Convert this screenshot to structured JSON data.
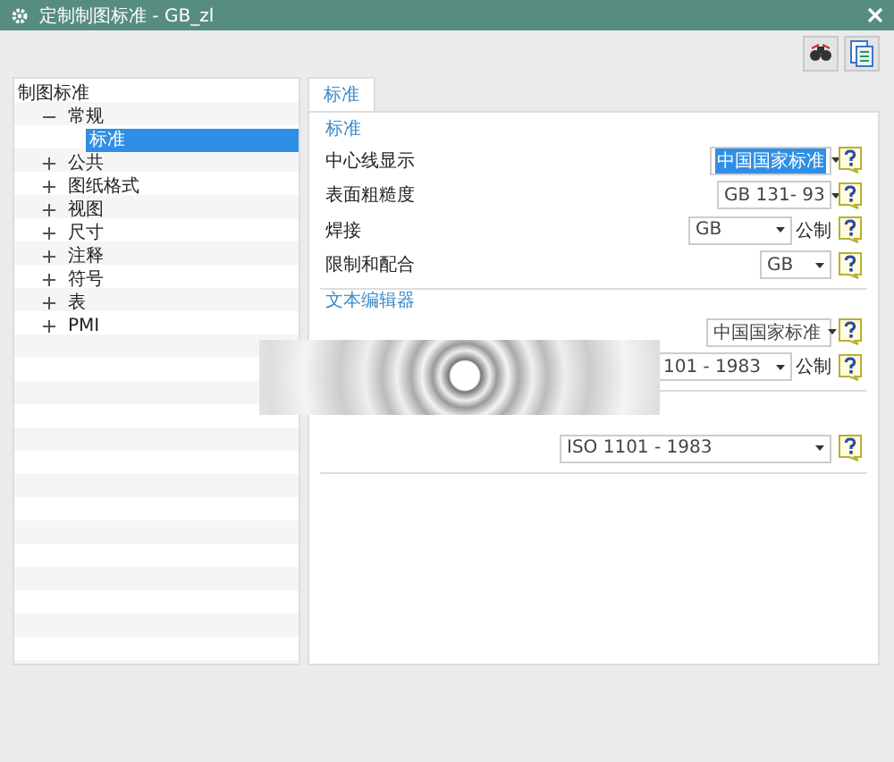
{
  "window": {
    "title": "定制制图标准 - GB_zl"
  },
  "tree": {
    "label": "制图标准",
    "children": [
      {
        "label": "常规",
        "expanded": true,
        "selected": false,
        "children": [
          {
            "label": "标准",
            "selected": true
          }
        ]
      },
      {
        "label": "公共",
        "expanded": false,
        "selected": false
      },
      {
        "label": "图纸格式",
        "expanded": false,
        "selected": false
      },
      {
        "label": "视图",
        "expanded": false,
        "selected": false
      },
      {
        "label": "尺寸",
        "expanded": false,
        "selected": false
      },
      {
        "label": "注释",
        "expanded": false,
        "selected": false
      },
      {
        "label": "符号",
        "expanded": false,
        "selected": false
      },
      {
        "label": "表",
        "expanded": false,
        "selected": false
      },
      {
        "label": "PMI",
        "expanded": false,
        "selected": false
      }
    ]
  },
  "tabs": [
    {
      "label": "标准",
      "selected": true
    }
  ],
  "groups": [
    {
      "title": "标准",
      "rows": [
        {
          "label": "中心线显示",
          "value": "中国国家标准",
          "highlighted": true
        },
        {
          "label": "表面粗糙度",
          "value": "GB 131- 93",
          "highlighted": false
        },
        {
          "label": "焊接",
          "value": "GB",
          "unit": "公制",
          "highlighted": false
        },
        {
          "label": "限制和配合",
          "value": "GB",
          "highlighted": false
        }
      ]
    },
    {
      "title": "文本编辑器",
      "rows": [
        {
          "value": "中国国家标准",
          "highlighted": false
        },
        {
          "value": "101 - 1983",
          "unit": "公制",
          "highlighted": false
        }
      ]
    },
    {
      "rows": [
        {
          "value": "ISO 1101 - 1983",
          "highlighted": false
        }
      ]
    }
  ]
}
